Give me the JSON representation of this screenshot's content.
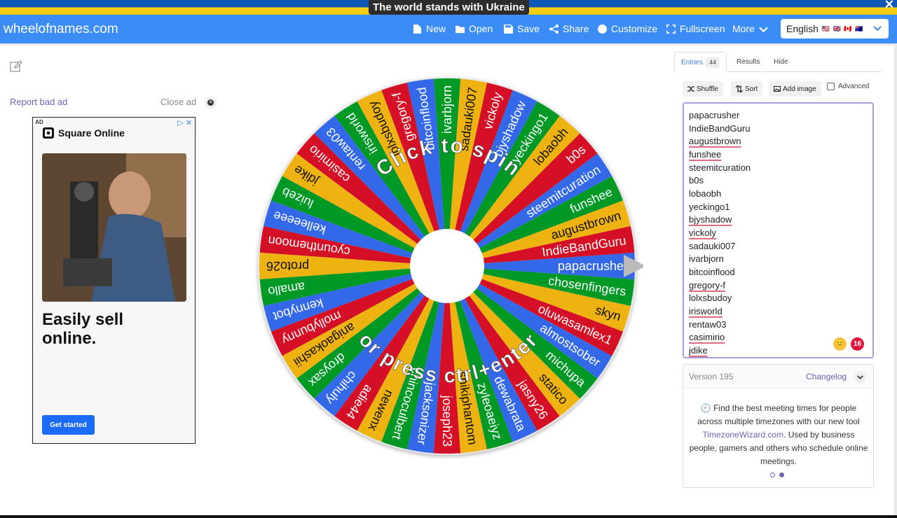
{
  "banner": {
    "text": "The world stands with Ukraine",
    "close": "✕"
  },
  "navbar": {
    "brand": "wheelofnames.com",
    "items": [
      {
        "label": "New",
        "icon": "file-icon"
      },
      {
        "label": "Open",
        "icon": "folder-icon"
      },
      {
        "label": "Save",
        "icon": "save-icon"
      },
      {
        "label": "Share",
        "icon": "share-icon"
      },
      {
        "label": "Customize",
        "icon": "palette-icon"
      },
      {
        "label": "Fullscreen",
        "icon": "fullscreen-icon"
      },
      {
        "label": "More",
        "icon": "caret-down-icon"
      }
    ],
    "language": {
      "label": "English",
      "flags": "🇺🇸 🇬🇧 🇨🇦 🇦🇺"
    }
  },
  "ad": {
    "report": "Report bad ad",
    "close": "Close ad",
    "badge": "AD",
    "brand": "Square Online",
    "headline": "Easily sell online.",
    "cta": "Get started"
  },
  "wheel": {
    "center_text_top": "Click to spin",
    "center_text_bottom": "or press ctrl+enter",
    "colors": [
      "#3369e8",
      "#d50f25",
      "#eeb211",
      "#009925"
    ],
    "slices": [
      "papacrusher",
      "IndieBandGuru",
      "augustbrown",
      "funshee",
      "steemitcuration",
      "b0s",
      "lobaobh",
      "yeckingo1",
      "bjyshadow",
      "vickoly",
      "sadauki007",
      "ivarbjorn",
      "bitcoinflood",
      "gregory-f",
      "lolxsbudoy",
      "irisworld",
      "rentaw03",
      "casimirio",
      "jdike",
      "luizeb",
      "kelleeeee",
      "cyounthemoon",
      "proto26",
      "amallo",
      "kennybot",
      "mollybunny",
      "anigaokashii",
      "droysax",
      "chihuly",
      "adie44",
      "newenx",
      "chincoculbert",
      "jacksonizer",
      "joseph23",
      "shikiphantom",
      "zyleoaeiyz",
      "dewabrata",
      "jasny26",
      "statico",
      "michupa",
      "almostsober",
      "oluwasamlex1",
      "skyn",
      "chosenfingers"
    ]
  },
  "panel": {
    "tabs": [
      {
        "label": "Entries",
        "count": "44"
      },
      {
        "label": "Results"
      },
      {
        "label": "Hide"
      }
    ],
    "tools": {
      "shuffle": "Shuffle",
      "sort": "Sort",
      "add_image": "Add image",
      "advanced": "Advanced"
    },
    "entries": [
      "papacrusher",
      "IndieBandGuru",
      "augustbrown",
      "funshee",
      "steemitcuration",
      "b0s",
      "lobaobh",
      "yeckingo1",
      "bjyshadow",
      "vickoly",
      "sadauki007",
      "ivarbjorn",
      "bitcoinflood",
      "gregory-f",
      "lolxsbudoy",
      "irisworld",
      "rentaw03",
      "casimirio",
      "jdike"
    ],
    "emoji": "😐",
    "error_count": "16",
    "version": "Version 195",
    "changelog": "Changelog",
    "info_text_1": "Find the best meeting times for people across multiple timezones with our new tool",
    "info_link": "TimezoneWizard.com",
    "info_text_2": ". Used by business people, gamers and others who schedule online meetings."
  }
}
